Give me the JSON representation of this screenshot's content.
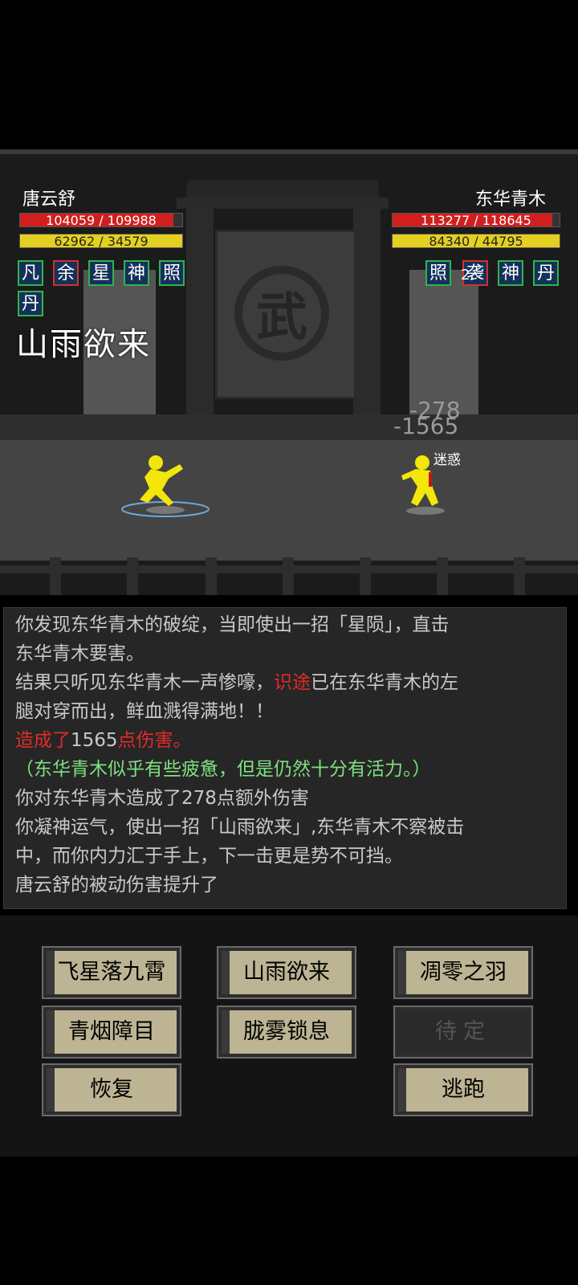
{
  "player": {
    "name": "唐云舒",
    "hp_text": "104059 / 109988",
    "hp_fraction": 0.946,
    "mp_text": "62962 / 34579",
    "mp_fraction": 1.0,
    "buffs": [
      "凡",
      "余",
      "星",
      "神",
      "照",
      "丹"
    ]
  },
  "enemy": {
    "name": "东华青木",
    "hp_text": "113277 / 118645",
    "hp_fraction": 0.955,
    "mp_text": "84340 / 44795",
    "mp_fraction": 1.0,
    "buffs": [
      "照",
      "袭",
      "神",
      "丹"
    ],
    "buff_stack": "2",
    "status": "迷惑"
  },
  "arena": {
    "emblem": "武",
    "skill_banner": "山雨欲来",
    "damage_floats": [
      "-278",
      "-1565"
    ]
  },
  "log": {
    "lines": [
      {
        "parts": [
          {
            "t": "你发现东华青木的破绽，当即使出一招「星陨」，直击",
            "c": ""
          }
        ]
      },
      {
        "parts": [
          {
            "t": "东华青木要害。",
            "c": ""
          }
        ]
      },
      {
        "parts": [
          {
            "t": "结果只听见东华青木一声惨嚎，",
            "c": ""
          },
          {
            "t": "识途",
            "c": "red"
          },
          {
            "t": "已在东华青木的左",
            "c": ""
          }
        ]
      },
      {
        "parts": [
          {
            "t": "腿对穿而出，鲜血溅得满地！！",
            "c": ""
          }
        ]
      },
      {
        "parts": [
          {
            "t": "造成了",
            "c": "red"
          },
          {
            "t": "1565",
            "c": ""
          },
          {
            "t": "点伤害。",
            "c": "red"
          }
        ]
      },
      {
        "parts": [
          {
            "t": "（东华青木似乎有些疲惫，但是仍然十分有活力。）",
            "c": "green"
          }
        ]
      },
      {
        "parts": [
          {
            "t": "你对东华青木造成了278点额外伤害",
            "c": ""
          }
        ]
      },
      {
        "parts": [
          {
            "t": "你凝神运气，使出一招「山雨欲来」,东华青木不察被击",
            "c": ""
          }
        ]
      },
      {
        "parts": [
          {
            "t": "中，而你内力汇于手上，下一击更是势不可挡。",
            "c": ""
          }
        ]
      },
      {
        "parts": [
          {
            "t": "唐云舒的被动伤害提升了",
            "c": ""
          }
        ]
      }
    ]
  },
  "buttons": {
    "skill1": "飞星落九霄",
    "skill2": "山雨欲来",
    "skill3": "凋零之羽",
    "skill4": "青烟障目",
    "skill5": "胧雾锁息",
    "skill6": "待定",
    "recover": "恢复",
    "flee": "逃跑"
  },
  "colors": {
    "hp": "#d11f1f",
    "mp": "#e3d020",
    "button": "#bdb493",
    "fighter": "#f2e60a"
  }
}
